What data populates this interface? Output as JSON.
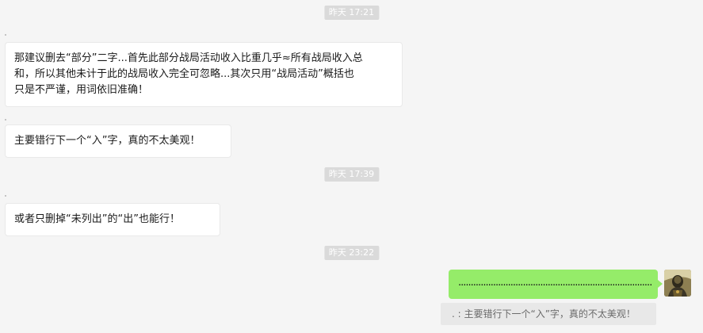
{
  "messages": [
    {
      "type": "time",
      "text": "昨天 17:21"
    },
    {
      "type": "in",
      "lines": [
        "那建议删去“部分”二字...首先此部分战局活动收入比重几乎≈所有战局收入总",
        "和，所以其他未计于此的战局收入完全可忽略...其次只用“战局活动”概括也",
        "只是不严谨，用词依旧准确！"
      ]
    },
    {
      "type": "in",
      "lines": [
        "主要错行下一个“入”字，真的不太美观！"
      ]
    },
    {
      "type": "time",
      "text": "昨天 17:39"
    },
    {
      "type": "in",
      "lines": [
        "或者只删掉“未列出”的“出”也能行！"
      ]
    },
    {
      "type": "time",
      "text": "昨天 23:22"
    },
    {
      "type": "out",
      "text": "................................................................................................"
    },
    {
      "type": "quote",
      "text": ". : 主要错行下一个“入”字，真的不太美观！"
    }
  ]
}
